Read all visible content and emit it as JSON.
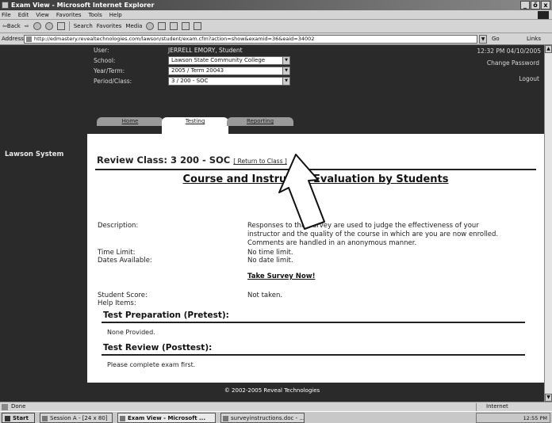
{
  "window": {
    "title": "Exam View - Microsoft Internet Explorer",
    "buttons": [
      "_",
      "ő",
      "x"
    ]
  },
  "menu": [
    "File",
    "Edit",
    "View",
    "Favorites",
    "Tools",
    "Help"
  ],
  "toolbar": {
    "back": "⇦Back",
    "forward": "⇨",
    "search": "Search",
    "favorites": "Favorites",
    "media": "Media"
  },
  "address": {
    "label": "Address",
    "url": "http://edmastery.revealtechnologies.com/lawson/student/exam.cfm?action=show&examid=36&eaid=34002",
    "go": "Go",
    "links": "Links"
  },
  "header": {
    "user_label": "User:",
    "user_value": "JERRELL EMORY, Student",
    "school_label": "School:",
    "school_value": "Lawson State Community College",
    "term_label": "Year/Term:",
    "term_value": "2005 / Term 20043",
    "period_label": "Period/Class:",
    "period_value": "3 / 200 - SOC",
    "clock": "12:32 PM 04/10/2005",
    "change_password": "Change Password",
    "logout": "Logout"
  },
  "tabs": [
    "Home",
    "Testing",
    "Reporting"
  ],
  "sidebar": {
    "system": "Lawson System"
  },
  "content": {
    "review_title": "Review Class: 3 200 - SOC",
    "return_link": "[ Return to Class ]",
    "heading": "Course and Instructor Evaluation by Students",
    "description_label": "Description:",
    "description_lines": [
      "Responses to this survey are used to judge the effectiveness of your",
      "instructor and the quality of the course in which are you are now enrolled.",
      "Comments are handled in an anonymous manner."
    ],
    "time_limit_label": "Time Limit:",
    "time_limit_value": "No time limit.",
    "dates_label": "Dates Available:",
    "dates_value": "No date limit.",
    "survey_link": "Take Survey Now!",
    "score_label": "Student Score:",
    "score_value": "Not taken.",
    "help_label": "Help Items:",
    "prep_title": "Test Preparation (Pretest):",
    "prep_body": "None Provided.",
    "review_sec_title": "Test Review (Posttest):",
    "review_sec_body": "Please complete exam first."
  },
  "footer": "© 2002-2005 Reveal Technologies",
  "status": {
    "text": "Done",
    "zone": "Internet"
  },
  "taskbar": {
    "start": "Start",
    "items": [
      "Session A - [24 x 80]",
      "Exam View - Microsoft ...",
      "surveyinstructions.doc - ..."
    ],
    "clock": "12:55 PM"
  }
}
